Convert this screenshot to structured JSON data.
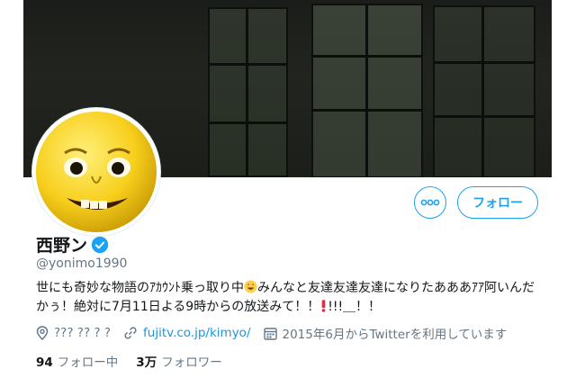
{
  "header": {
    "banner": {
      "description_icon": "dark-window-banner"
    }
  },
  "profile": {
    "name": "西野ン",
    "handle": "@yonimo1990",
    "bio_part1": "世にも奇妙な物語のｱｶｳﾝﾄ乗っ取り中",
    "bio_part2": "みんなと友達友達友達になりたあああｱｱ阿いんだかぅ！絶対に7月11日よる9時からの放送みて！！",
    "bio_part3": "!!!＿！！",
    "location": "??? ?? ? ?",
    "website": "fujitv.co.jp/kimyo/",
    "joined": "2015年6月からTwitterを利用しています"
  },
  "actions": {
    "follow_label": "フォロー",
    "more_icon": "more-dots-icon"
  },
  "stats": {
    "following_count": "94",
    "following_label": "フォロー中",
    "followers_count": "3万",
    "followers_label": "フォロワー"
  },
  "colors": {
    "accent": "#1da1f2",
    "secondary_text": "#657786",
    "avatar_yellow": "#fbd428"
  }
}
